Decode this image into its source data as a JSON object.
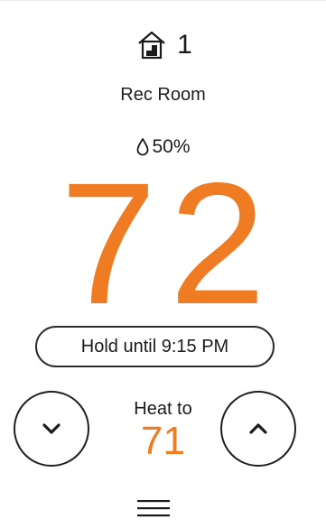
{
  "zone": {
    "icon": "home-zone-icon",
    "number": "1"
  },
  "room": {
    "name": "Rec Room"
  },
  "humidity": {
    "icon": "humidity-drop-icon",
    "value": "50%"
  },
  "current_temperature": "72",
  "hold": {
    "label": "Hold until 9:15 PM"
  },
  "setpoint": {
    "label": "Heat to",
    "value": "71",
    "decrease_icon": "chevron-down-icon",
    "increase_icon": "chevron-up-icon"
  },
  "menu": {
    "icon": "hamburger-menu-icon"
  },
  "colors": {
    "accent": "#ef7b22",
    "text": "#1a1a1a",
    "background": "#ffffff"
  }
}
